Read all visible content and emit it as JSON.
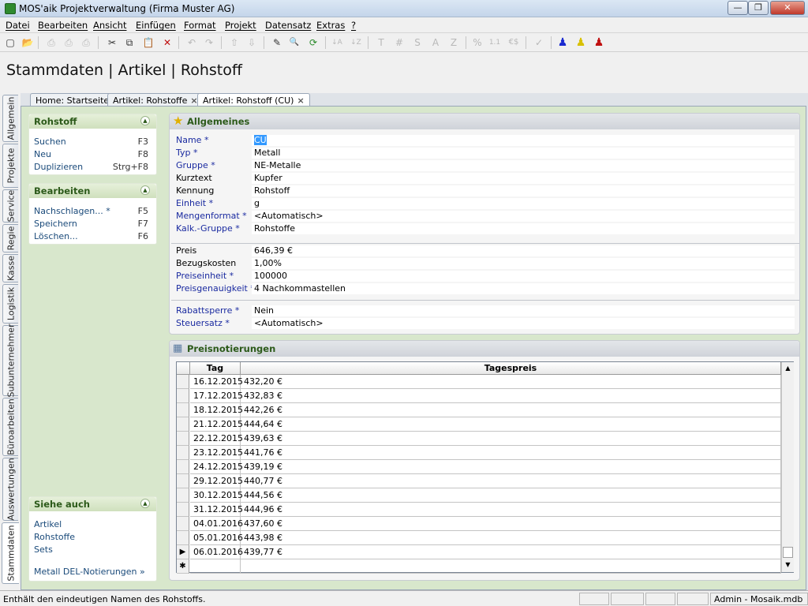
{
  "window": {
    "title": "MOS'aik Projektverwaltung (Firma Muster AG)",
    "minimize_glyph": "—",
    "restore_glyph": "❐",
    "close_glyph": "✕"
  },
  "menu": [
    "Datei",
    "Bearbeiten",
    "Ansicht",
    "Einfügen",
    "Format",
    "Projekt",
    "Datensatz",
    "Extras",
    "?"
  ],
  "toolbar": {
    "icons": [
      "new-icon",
      "open-icon",
      "print-icon",
      "print-preview-icon",
      "print-setup-icon",
      "cut-icon",
      "copy-icon",
      "paste-icon",
      "delete-icon",
      "undo-icon",
      "redo-icon",
      "move-up-icon",
      "move-down-icon",
      "edit-icon",
      "search-icon",
      "refresh-icon",
      "sort-asc-icon",
      "sort-desc-icon",
      "text-icon",
      "hash-icon",
      "s-icon",
      "a-icon",
      "z-icon",
      "percent-icon",
      "precision-icon",
      "currency-icon",
      "check-icon",
      "user-blue-icon",
      "user-yellow-icon",
      "user-red-icon"
    ],
    "glyphs": [
      "▢",
      "📂",
      "⎙",
      "⎙",
      "⎙",
      "✂",
      "⧉",
      "📋",
      "✕",
      "↶",
      "↷",
      "⇧",
      "⇩",
      "✎",
      "🔍",
      "⟳",
      "↓A",
      "↓Z",
      "T",
      "#",
      "S",
      "A",
      "Z",
      "%",
      "1.1",
      "€$",
      "✓",
      "♟",
      "♟",
      "♟"
    ]
  },
  "page": {
    "title": "Stammdaten | Artikel | Rohstoff"
  },
  "left_tabs": [
    "Allgemein",
    "Projekte",
    "Service",
    "Regie",
    "Kasse",
    "Logistik",
    "Subunternehmer",
    "Büroarbeiten",
    "Auswertungen",
    "Stammdaten"
  ],
  "doc_tabs": [
    {
      "label": "Home: Startseite",
      "closable": false
    },
    {
      "label": "Artikel: Rohstoffe",
      "closable": true
    },
    {
      "label": "Artikel: Rohstoff (CU)",
      "closable": true
    }
  ],
  "close_glyph": "×",
  "sidebar": {
    "caret_glyph": "▲",
    "rohstoff": {
      "title": "Rohstoff",
      "items": [
        {
          "label": "Suchen",
          "key": "F3"
        },
        {
          "label": "Neu",
          "key": "F8"
        },
        {
          "label": "Duplizieren",
          "key": "Strg+F8"
        }
      ]
    },
    "bearbeiten": {
      "title": "Bearbeiten",
      "items": [
        {
          "label": "Nachschlagen... *",
          "key": "F5"
        },
        {
          "label": "Speichern",
          "key": "F7"
        },
        {
          "label": "Löschen...",
          "key": "F6"
        }
      ]
    },
    "siehe_auch": {
      "title": "Siehe auch",
      "items": [
        "Artikel",
        "Rohstoffe",
        "Sets"
      ],
      "extra_link": "Metall DEL-Notierungen »"
    }
  },
  "allgemeines": {
    "title": "Allgemeines",
    "fields": [
      {
        "label": "Name *",
        "value": "CU",
        "required": true
      },
      {
        "label": "Typ *",
        "value": "Metall",
        "required": true
      },
      {
        "label": "Gruppe *",
        "value": "NE-Metalle",
        "required": true
      },
      {
        "label": "Kurztext",
        "value": "Kupfer",
        "required": false
      },
      {
        "label": "Kennung",
        "value": "Rohstoff",
        "required": false
      },
      {
        "label": "Einheit *",
        "value": "g",
        "required": true
      },
      {
        "label": "Mengenformat *",
        "value": "<Automatisch>",
        "required": true
      },
      {
        "label": "Kalk.-Gruppe *",
        "value": "Rohstoffe",
        "required": true
      },
      {
        "label": "Preis",
        "value": "646,39 €",
        "required": false
      },
      {
        "label": "Bezugskosten",
        "value": "1,00%",
        "required": false
      },
      {
        "label": "Preiseinheit *",
        "value": "100000",
        "required": true
      },
      {
        "label": "Preisgenauigkeit *",
        "value": "4 Nachkommastellen",
        "required": true
      },
      {
        "label": "Rabattsperre *",
        "value": "Nein",
        "required": true
      },
      {
        "label": "Steuersatz *",
        "value": "<Automatisch>",
        "required": true
      }
    ]
  },
  "preisnotierungen": {
    "title": "Preisnotierungen",
    "columns": [
      "Tag",
      "Tagespreis"
    ],
    "rows": [
      [
        "16.12.2015",
        "432,20 €"
      ],
      [
        "17.12.2015",
        "432,83 €"
      ],
      [
        "18.12.2015",
        "442,26 €"
      ],
      [
        "21.12.2015",
        "444,64 €"
      ],
      [
        "22.12.2015",
        "439,63 €"
      ],
      [
        "23.12.2015",
        "441,76 €"
      ],
      [
        "24.12.2015",
        "439,19 €"
      ],
      [
        "29.12.2015",
        "440,77 €"
      ],
      [
        "30.12.2015",
        "444,56 €"
      ],
      [
        "31.12.2015",
        "444,96 €"
      ],
      [
        "04.01.2016",
        "437,60 €"
      ],
      [
        "05.01.2016",
        "443,98 €"
      ],
      [
        "06.01.2016",
        "439,77 €"
      ]
    ],
    "current_row_marker": "▶",
    "new_row_marker": "✱",
    "scroll_up_glyph": "▲",
    "scroll_down_glyph": "▼"
  },
  "status": {
    "text": "Enthält den eindeutigen Namen des Rohstoffs.",
    "db": "Admin - Mosaik.mdb"
  },
  "colors": {
    "accent_green": "#2c5a1a",
    "required_label": "#1a2aa0",
    "content_bg": "#d8e7cc"
  }
}
